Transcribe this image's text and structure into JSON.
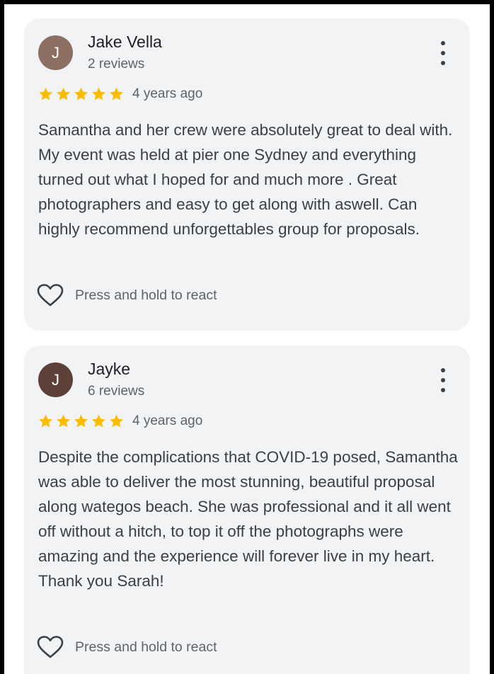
{
  "colors": {
    "card_background": "#f1f3f4",
    "star": "#fbbc04",
    "avatar_1": "#8d6e63",
    "avatar_2": "#5d4037"
  },
  "reviews": [
    {
      "avatar_letter": "J",
      "name": "Jake Vella",
      "review_count": "2 reviews",
      "rating": 5,
      "time": "4 years ago",
      "text": "Samantha and her crew were absolutely great to deal with. My event was held at pier one Sydney and everything turned out what I hoped for and much more . Great photographers and easy to get along with aswell. Can highly recommend unforgettables group for proposals.",
      "react_label": "Press and hold to react",
      "react_icon": "heart-outline-icon",
      "menu_icon": "more-vert-icon"
    },
    {
      "avatar_letter": "J",
      "name": "Jayke",
      "review_count": "6 reviews",
      "rating": 5,
      "time": "4 years ago",
      "text": "Despite the complications that COVID-19 posed, Samantha was able to deliver the most stunning, beautiful proposal along wategos beach. She was professional and it all went off without a hitch, to top it off the photographs were amazing and the experience will forever live in my heart. Thank you Sarah!",
      "react_label": "Press and hold to react",
      "react_icon": "heart-outline-icon",
      "menu_icon": "more-vert-icon"
    }
  ]
}
